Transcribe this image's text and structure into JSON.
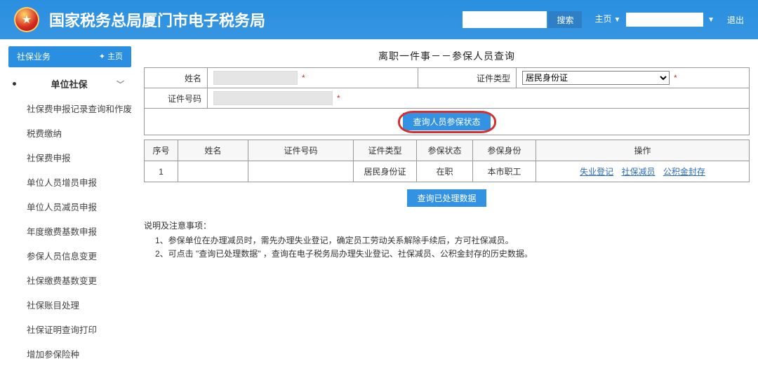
{
  "header": {
    "title": "国家税务总局厦门市电子税务局",
    "search_placeholder": "",
    "search_btn": "搜索",
    "home_link": "主页",
    "logout_link": "退出"
  },
  "sidebar": {
    "head": "社保业务",
    "home_btn": "✦ 主页",
    "group": "单位社保",
    "items": [
      "社保费申报记录查询和作废",
      "税费缴纳",
      "社保费申报",
      "单位人员增员申报",
      "单位人员减员申报",
      "年度缴费基数申报",
      "参保人员信息变更",
      "社保缴费基数变更",
      "社保账目处理",
      "社保证明查询打印",
      "增加参保险种"
    ]
  },
  "main": {
    "page_title": "离职一件事－－参保人员查询",
    "labels": {
      "name": "姓名",
      "id_type": "证件类型",
      "id_number": "证件号码"
    },
    "values": {
      "name": "",
      "id_number": ""
    },
    "id_type_options": [
      "居民身份证"
    ],
    "id_type_selected": "居民身份证",
    "query_status_btn": "查询人员参保状态",
    "table_headers": [
      "序号",
      "姓名",
      "证件号码",
      "证件类型",
      "参保状态",
      "参保身份",
      "操作"
    ],
    "rows": [
      {
        "index": "1",
        "name": "",
        "id_number": "",
        "id_type": "居民身份证",
        "status": "在职",
        "identity": "本市职工",
        "ops": [
          "失业登记",
          "社保减员",
          "公积金封存"
        ]
      }
    ],
    "processed_btn": "查询已处理数据",
    "notes_title": "说明及注意事项：",
    "notes": [
      "1、参保单位在办理减员时，需先办理失业登记，确定员工劳动关系解除手续后，方可社保减员。",
      "2、可点击 \"查询已处理数据\" ，查询在电子税务局办理失业登记、社保减员、公积金封存的历史数据。"
    ]
  }
}
